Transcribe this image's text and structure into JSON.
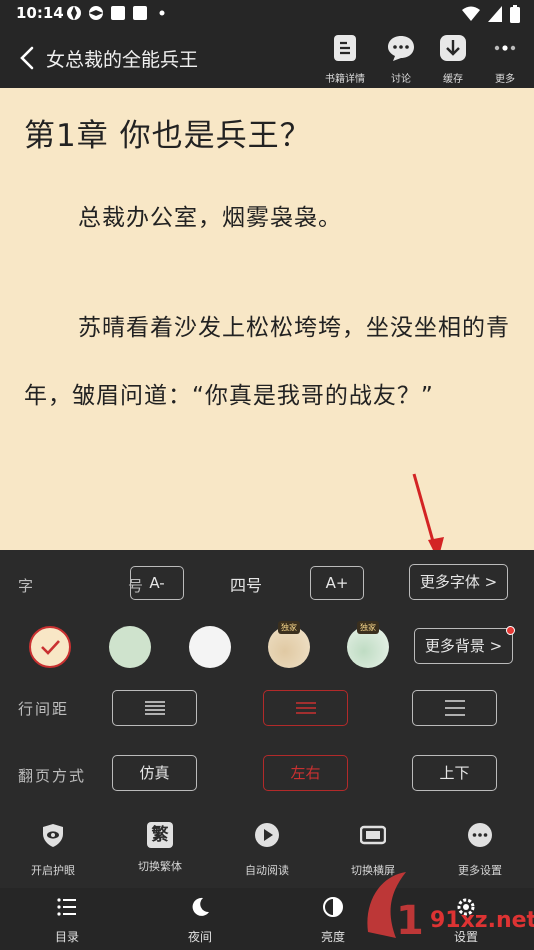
{
  "status_bar": {
    "time": "10:14"
  },
  "app_bar": {
    "title": "女总裁的全能兵王",
    "actions": [
      {
        "label": "书籍详情",
        "icon": "book-details-icon"
      },
      {
        "label": "讨论",
        "icon": "chat-bubble-icon"
      },
      {
        "label": "缓存",
        "icon": "download-icon"
      },
      {
        "label": "更多",
        "icon": "more-dots-icon"
      }
    ]
  },
  "reader": {
    "chapter_title": "第1章 你也是兵王？",
    "paragraphs": [
      "总裁办公室，烟雾袅袅。",
      "苏晴看着沙发上松松垮垮，坐没坐相的青年，皱眉问道：“你真是我哥的战友？”"
    ],
    "background_color": "#f8e7c6"
  },
  "settings": {
    "font_size": {
      "label": "字　号",
      "decrease": "A-",
      "current": "四号",
      "increase": "A+",
      "more": "更多字体 >"
    },
    "background": {
      "swatches": [
        {
          "color": "#f8e7c6",
          "selected": true
        },
        {
          "color": "#cfe3cd",
          "selected": false
        },
        {
          "color": "#f4f4f4",
          "selected": false
        },
        {
          "color": "#ecdcc0",
          "selected": false,
          "badge": "独家"
        },
        {
          "color": "#e3efe4",
          "selected": false,
          "badge": "独家"
        }
      ],
      "more": "更多背景 >"
    },
    "line_spacing": {
      "label": "行间距",
      "options": [
        "compact",
        "medium",
        "loose"
      ],
      "selected": 1
    },
    "page_turn": {
      "label": "翻页方式",
      "options": [
        "仿真",
        "左右",
        "上下"
      ],
      "selected": 1
    },
    "accent_color": "#c93131"
  },
  "tools": [
    {
      "label": "开启护眼",
      "icon": "eye-shield-icon"
    },
    {
      "label": "切换繁体",
      "icon": "traditional-char-icon",
      "glyph": "繁"
    },
    {
      "label": "自动阅读",
      "icon": "play-icon"
    },
    {
      "label": "切换横屏",
      "icon": "landscape-icon"
    },
    {
      "label": "更多设置",
      "icon": "more-settings-icon"
    }
  ],
  "bottom_nav": [
    {
      "label": "目录",
      "icon": "list-icon"
    },
    {
      "label": "夜间",
      "icon": "moon-icon"
    },
    {
      "label": "亮度",
      "icon": "brightness-icon"
    },
    {
      "label": "设置",
      "icon": "settings-icon"
    }
  ],
  "watermark": {
    "text": "91xz.net"
  }
}
